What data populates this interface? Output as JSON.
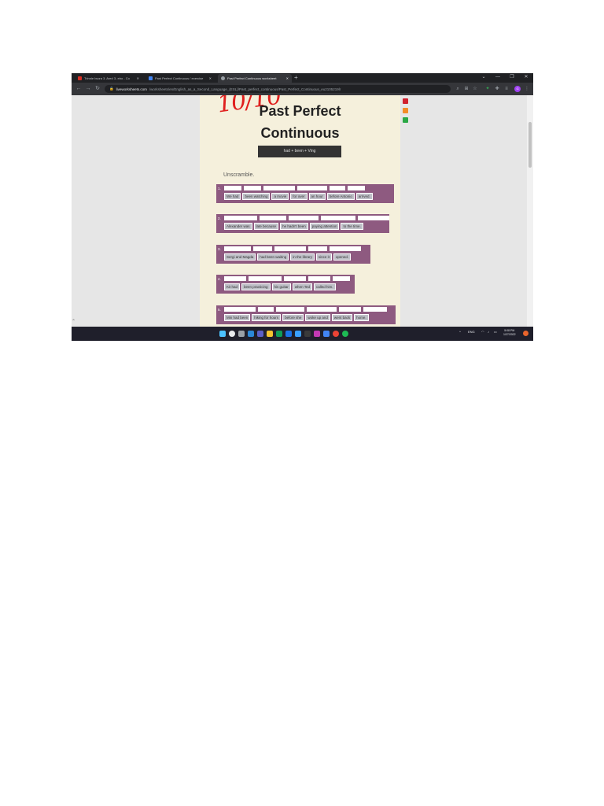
{
  "browser": {
    "tabs": [
      {
        "label": "Trinnie Iwora 3. Ared 3- ebo - Co",
        "active": false,
        "favicon_color": "#d93025"
      },
      {
        "label": "Past Perfect Continuous / exercise",
        "active": false,
        "favicon_color": "#4285f4"
      },
      {
        "label": "Past Perfect Continuous worksheet",
        "active": true,
        "favicon_color": "#9aa0a6"
      }
    ],
    "new_tab": "+",
    "url_host": "liveworksheets.com",
    "url_path": "/worksheets/en/English_as_a_Second_Language_(ESL)/Past_perfect_continuous/Past_Perfect_Continuous_eu2105219lr",
    "window_controls": [
      "⌄",
      "—",
      "❐",
      "✕"
    ]
  },
  "worksheet": {
    "score": "10/10",
    "title_line1": "Past Perfect",
    "title_line2": "Continuous",
    "formula": "had + been + Ving",
    "instruction": "Unscramble.",
    "items": [
      {
        "number": "1.",
        "slots": [
          22,
          22,
          40,
          38,
          20,
          22
        ],
        "chips": [
          "We had",
          "been watching",
          "a movie",
          "for over",
          "an hour",
          "before Antonio",
          "arrived."
        ]
      },
      {
        "number": "2.",
        "slots": [
          42,
          34,
          38,
          44,
          40
        ],
        "chips": [
          "Alexander was",
          "late because",
          "he hadn't been",
          "paying attention",
          "to the time."
        ]
      },
      {
        "number": "3.",
        "slots": [
          34,
          24,
          40,
          24,
          40
        ],
        "chips": [
          "Sergi and Magda",
          "had been waiting",
          "in the library",
          "since it",
          "opened."
        ]
      },
      {
        "number": "4.",
        "slots": [
          28,
          42,
          28,
          28,
          22
        ],
        "chips": [
          "Kit had",
          "been practicing",
          "his guitar",
          "when Ted",
          "called him."
        ]
      },
      {
        "number": "5.",
        "slots": [
          40,
          20,
          36,
          38,
          28,
          30
        ],
        "chips": [
          "Min had been",
          "hiking for hours",
          "before she",
          "woke up and",
          "went back",
          "home."
        ]
      }
    ],
    "side_icon_colors": [
      "#d0202f",
      "#f28c28",
      "#2aa846"
    ]
  },
  "taskbar": {
    "app_colors": [
      "#4cc2ff",
      "#e8eaed",
      "#5b5fc7",
      "#2b88d8",
      "#7b68ee",
      "#f4c430",
      "#0f9d58",
      "#1a73e8",
      "#3aa0ff",
      "#3a3a3a",
      "#c239b3",
      "#4285f4",
      "#ea4335",
      "#1db954"
    ],
    "tray_lang": "ENG",
    "time": "5:08 PM",
    "date": "1/27/2022"
  }
}
